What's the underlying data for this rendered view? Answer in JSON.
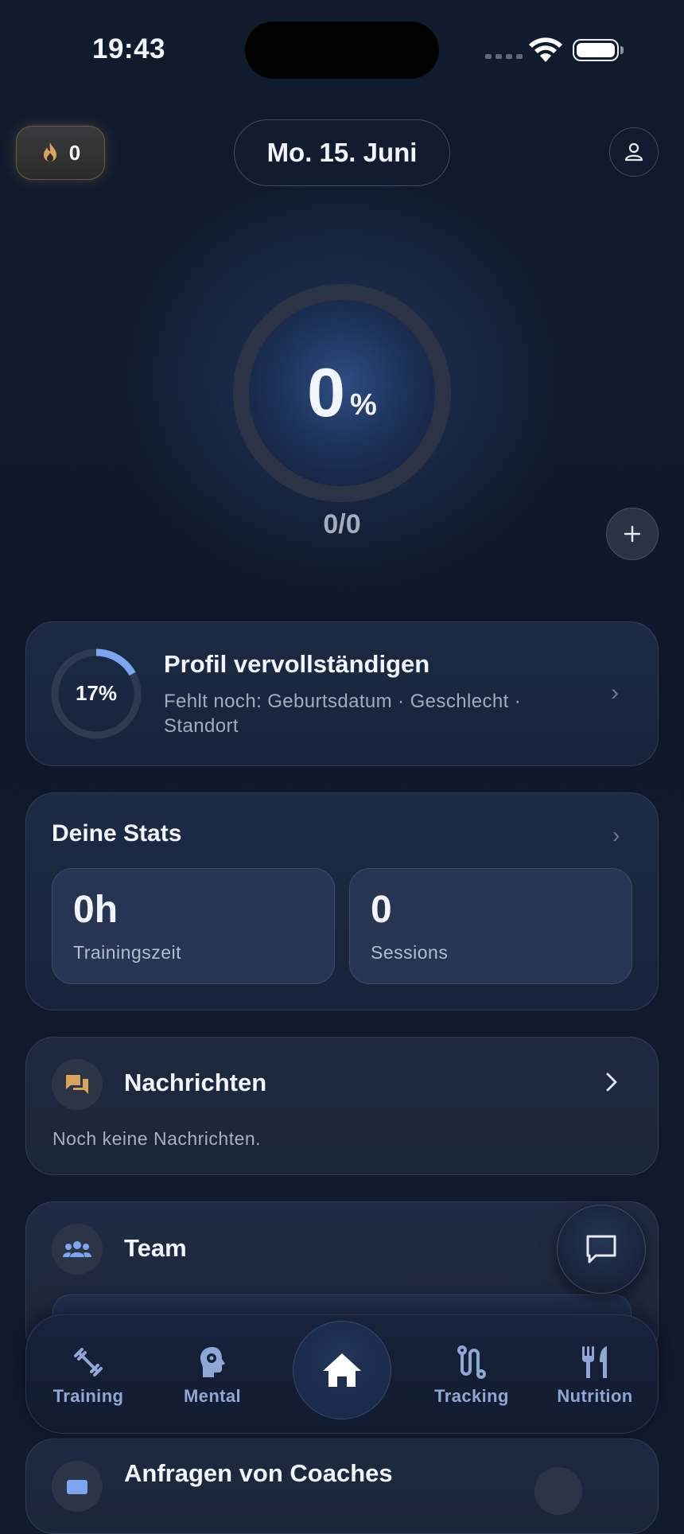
{
  "status_bar": {
    "time": "19:43"
  },
  "header": {
    "streak_count": "0",
    "date": "Mo. 15. Juni"
  },
  "progress": {
    "percent_value": "0",
    "percent_sign": "%",
    "ratio": "0/0",
    "fraction": 0
  },
  "profile_card": {
    "percent_label": "17%",
    "percent": 17,
    "title": "Profil vervollständigen",
    "subtitle": "Fehlt noch: Geburtsdatum · Geschlecht · Standort"
  },
  "stats": {
    "title": "Deine Stats",
    "items": [
      {
        "value": "0h",
        "label": "Trainingszeit"
      },
      {
        "value": "0",
        "label": "Sessions"
      }
    ]
  },
  "messages": {
    "title": "Nachrichten",
    "empty_text": "Noch keine Nachrichten."
  },
  "team": {
    "title": "Team"
  },
  "coach_requests": {
    "title": "Anfragen von Coaches"
  },
  "tabbar": {
    "items": [
      {
        "label": "Training",
        "icon": "dumbbell-icon"
      },
      {
        "label": "Mental",
        "icon": "brain-head-icon"
      },
      {
        "label": "",
        "icon": "home-icon"
      },
      {
        "label": "Tracking",
        "icon": "route-icon"
      },
      {
        "label": "Nutrition",
        "icon": "fork-knife-icon"
      }
    ]
  },
  "colors": {
    "accent": "#7ea6f0",
    "streak": "#d9a35c",
    "background": "#0f1a2c"
  }
}
